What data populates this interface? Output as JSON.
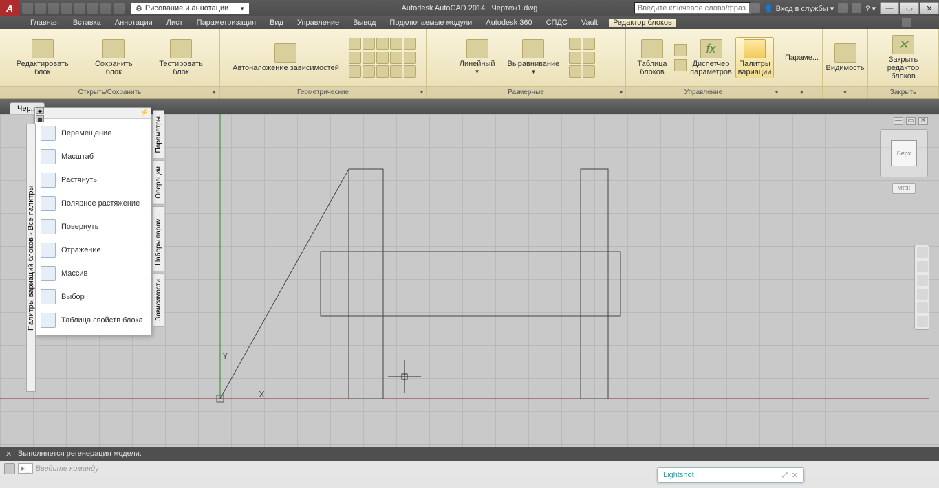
{
  "title": {
    "app": "Autodesk AutoCAD 2014",
    "doc": "Чертеж1.dwg"
  },
  "workspace": "Рисование и аннотации",
  "search_placeholder": "Введите ключевое слово/фразу",
  "login": "Вход в службы",
  "menus": [
    "Главная",
    "Вставка",
    "Аннотации",
    "Лист",
    "Параметризация",
    "Вид",
    "Управление",
    "Вывод",
    "Подключаемые модули",
    "Autodesk 360",
    "СПДС",
    "Vault",
    "Редактор блоков"
  ],
  "active_menu_index": 12,
  "ribbon": {
    "panels": [
      {
        "title": "Открыть/Сохранить",
        "buttons": [
          "Редактировать блок",
          "Сохранить блок",
          "Тестировать блок"
        ]
      },
      {
        "title": "Геометрические",
        "buttons": [
          "Автоналожение зависимостей"
        ]
      },
      {
        "title": "Размерные",
        "buttons": [
          "Линейный",
          "Выравнивание"
        ]
      },
      {
        "title": "Управление",
        "buttons": [
          "Таблица блоков",
          "",
          "Диспетчер параметров",
          "Палитры вариации"
        ],
        "fx": "fx"
      },
      {
        "title": "",
        "label": "Параме..."
      },
      {
        "title": "",
        "label": "Видимость"
      },
      {
        "title": "Закрыть",
        "buttons": [
          "Закрыть редактор блоков"
        ]
      }
    ]
  },
  "doc_tab": "Чер...",
  "palette_title": "Палитры вариаций блоков - Все палитры",
  "palette_items": [
    "Перемещение",
    "Масштаб",
    "Растянуть",
    "Полярное растяжение",
    "Повернуть",
    "Отражение",
    "Массив",
    "Выбор",
    "Таблица свойств блока"
  ],
  "side_tabs": [
    "Параметры",
    "Операции",
    "Наборы парам...",
    "Зависимости"
  ],
  "viewcube": {
    "face": "Верх",
    "coord": "МСК"
  },
  "command_log": "Выполняется регенерация модели.",
  "command_prompt": "Введите команду",
  "lightshot": "Lightshot",
  "axes": {
    "x": "X",
    "y": "Y"
  }
}
